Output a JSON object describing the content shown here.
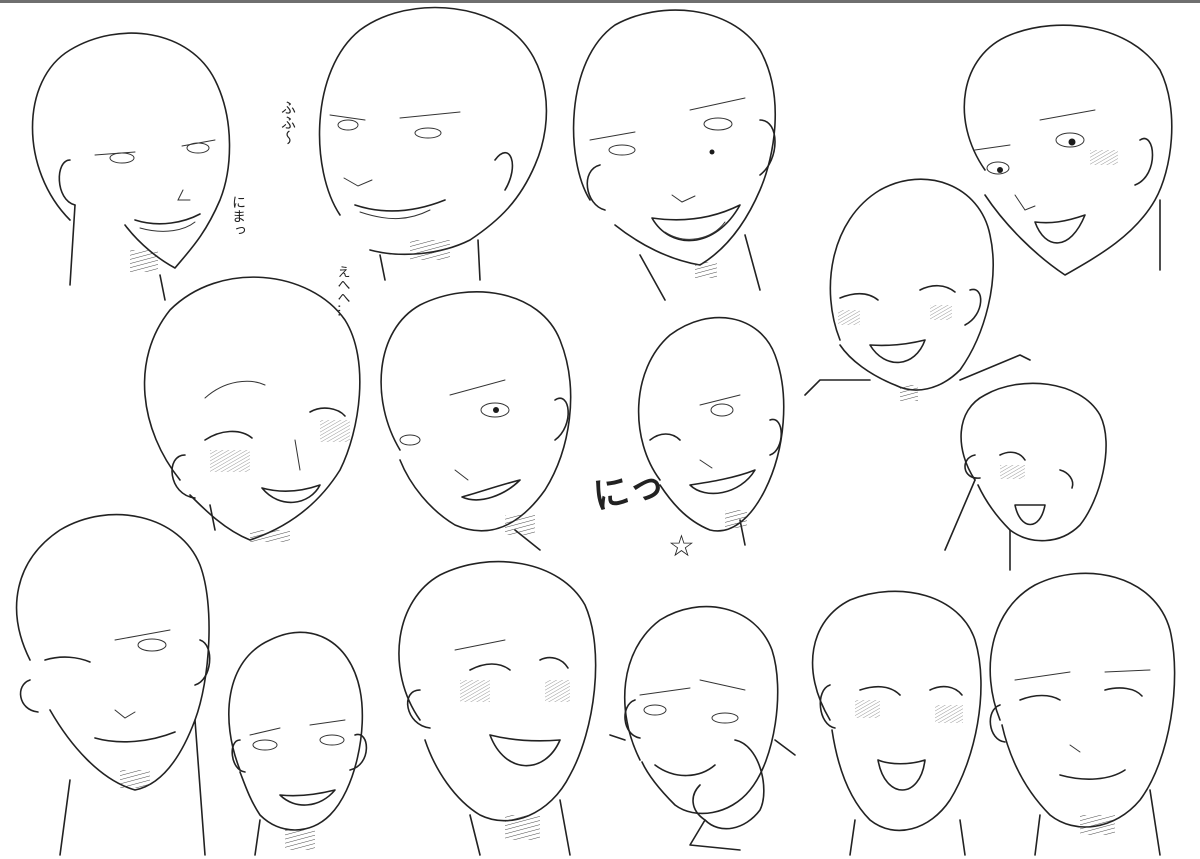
{
  "sheet": {
    "sfx": {
      "fufu": "ふふ〜",
      "nima": "にまっ",
      "ehehe": "えへへ…",
      "nitt": "にっ",
      "star": "☆"
    }
  },
  "colors": {
    "line": "#222222",
    "paper": "#ffffff",
    "frame": "#6f6f6f"
  }
}
